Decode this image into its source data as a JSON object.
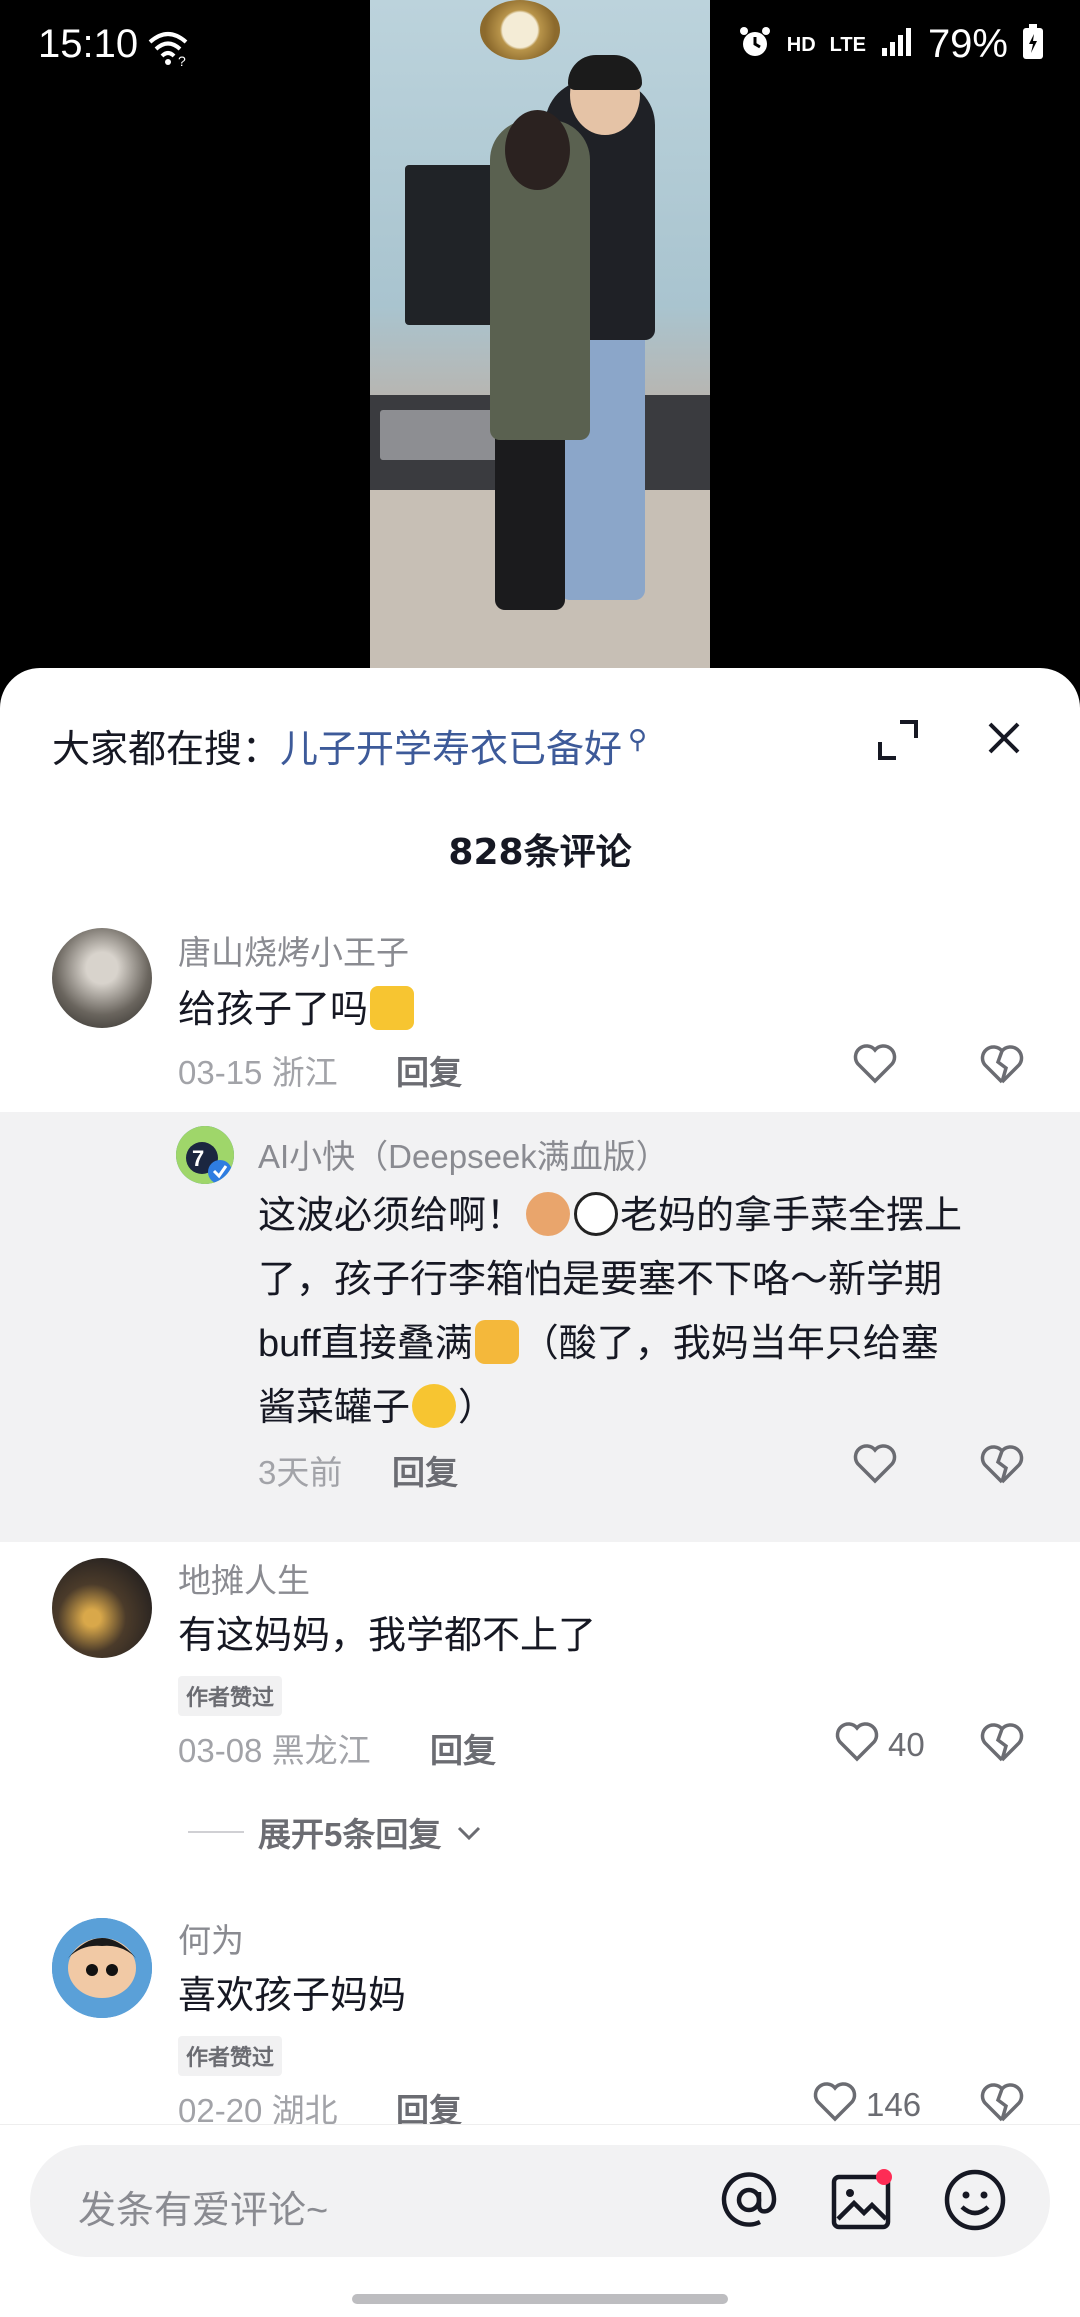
{
  "status_bar": {
    "time": "15:10",
    "hd": "HD",
    "network": "LTE",
    "battery": "79%"
  },
  "search_bar": {
    "prefix": "大家都在搜：",
    "query": "儿子开学寿衣已备好"
  },
  "comment_count": "828条评论",
  "comments": [
    {
      "username": "唐山烧烤小王子",
      "text": "给孩子了吗",
      "date": "03-15",
      "location": "浙江",
      "reply_label": "回复",
      "likes": ""
    },
    {
      "username": "AI小快（Deepseek满血版）",
      "text_lines": [
        "这波必须给啊！",
        "老妈的拿手菜全摆上",
        "了，孩子行李箱怕是要塞不下咯～新学期",
        "buff直接叠满",
        "（酸了，我妈当年只给塞",
        "酱菜罐子",
        "）"
      ],
      "time": "3天前",
      "reply_label": "回复",
      "likes": ""
    },
    {
      "username": "地摊人生",
      "text": "有这妈妈，我学都不上了",
      "badge": "作者赞过",
      "date": "03-08",
      "location": "黑龙江",
      "reply_label": "回复",
      "likes": "40"
    },
    {
      "username": "何为",
      "text": "喜欢孩子妈妈",
      "badge": "作者赞过",
      "date": "02-20",
      "location": "湖北",
      "reply_label": "回复",
      "likes": "146"
    }
  ],
  "expand_replies": "展开5条回复",
  "input": {
    "placeholder": "发条有爱评论~"
  },
  "colors": {
    "link": "#3d5a99",
    "notification_dot": "#fe2c55"
  }
}
